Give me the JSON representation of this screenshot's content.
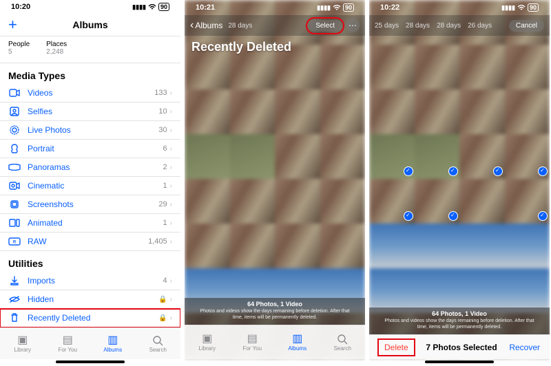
{
  "screen1": {
    "status": {
      "time": "10:20",
      "battery": "90"
    },
    "nav_title": "Albums",
    "album_people": {
      "label": "People",
      "count": "5"
    },
    "album_places": {
      "label": "Places",
      "count": "2,248"
    },
    "media_types_header": "Media Types",
    "media_types": [
      {
        "icon": "videos-icon",
        "label": "Videos",
        "count": "133"
      },
      {
        "icon": "selfies-icon",
        "label": "Selfies",
        "count": "10"
      },
      {
        "icon": "livephotos-icon",
        "label": "Live Photos",
        "count": "30"
      },
      {
        "icon": "portrait-icon",
        "label": "Portrait",
        "count": "6"
      },
      {
        "icon": "panoramas-icon",
        "label": "Panoramas",
        "count": "2"
      },
      {
        "icon": "cinematic-icon",
        "label": "Cinematic",
        "count": "1"
      },
      {
        "icon": "screenshots-icon",
        "label": "Screenshots",
        "count": "29"
      },
      {
        "icon": "animated-icon",
        "label": "Animated",
        "count": "1"
      },
      {
        "icon": "raw-icon",
        "label": "RAW",
        "count": "1,405"
      }
    ],
    "utilities_header": "Utilities",
    "utilities": [
      {
        "icon": "imports-icon",
        "label": "Imports",
        "count": "4",
        "lock": false
      },
      {
        "icon": "hidden-icon",
        "label": "Hidden",
        "count": "",
        "lock": true
      },
      {
        "icon": "trash-icon",
        "label": "Recently Deleted",
        "count": "",
        "lock": true,
        "highlight": true
      }
    ],
    "tabs": {
      "library": "Library",
      "foryou": "For You",
      "albums": "Albums",
      "search": "Search"
    }
  },
  "screen2": {
    "status": {
      "time": "10:21",
      "battery": "90"
    },
    "back_label": "Albums",
    "filter_label": "28 days",
    "select_label": "Select",
    "more_label": "⋯",
    "page_title": "Recently Deleted",
    "footer_bold": "64 Photos, 1 Video",
    "footer_text": "Photos and videos show the days remaining before deletion. After that time, items will be permanently deleted.",
    "tabs": {
      "library": "Library",
      "foryou": "For You",
      "albums": "Albums",
      "search": "Search"
    }
  },
  "screen3": {
    "status": {
      "time": "10:22",
      "battery": "90"
    },
    "filter_label_a": "25 days",
    "filter_label_b": "28 days",
    "filter_label_c": "28 days",
    "filter_label_d": "26 days",
    "cancel_label": "Cancel",
    "footer_bold": "64 Photos, 1 Video",
    "footer_text": "Photos and videos show the days remaining before deletion. After that time, items will be permanently deleted.",
    "toolbar": {
      "delete": "Delete",
      "middle": "7 Photos Selected",
      "recover": "Recover"
    }
  },
  "icons_svg": {}
}
